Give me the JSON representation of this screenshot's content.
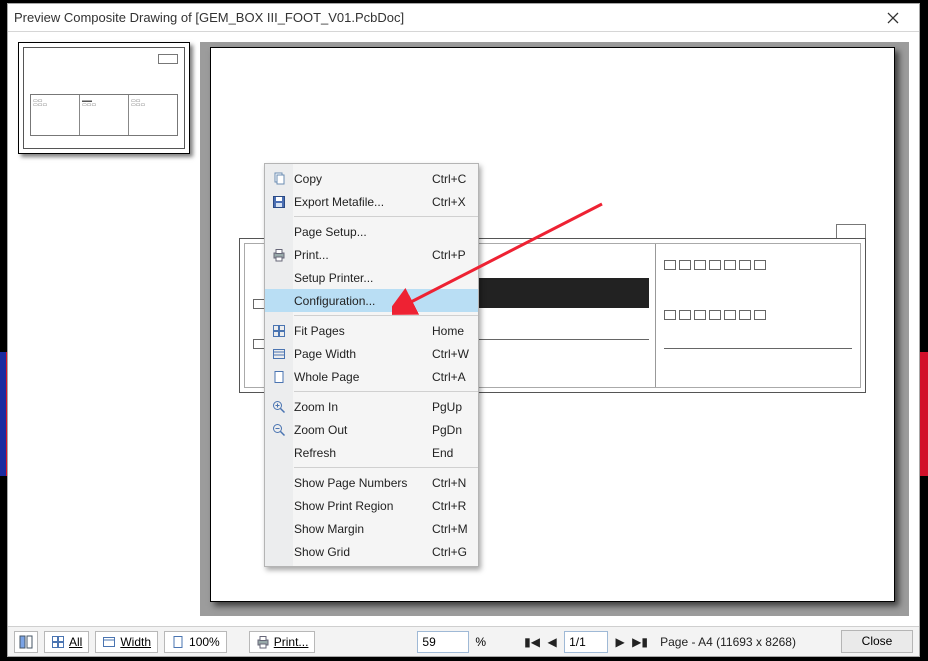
{
  "window": {
    "title": "Preview Composite Drawing of [GEM_BOX III_FOOT_V01.PcbDoc]"
  },
  "context_menu": {
    "groups": [
      [
        {
          "label": "Copy",
          "shortcut": "Ctrl+C",
          "icon": "copy-icon"
        },
        {
          "label": "Export Metafile...",
          "shortcut": "Ctrl+X",
          "icon": "save-icon"
        }
      ],
      [
        {
          "label": "Page Setup...",
          "shortcut": "",
          "icon": ""
        },
        {
          "label": "Print...",
          "shortcut": "Ctrl+P",
          "icon": "print-icon"
        },
        {
          "label": "Setup Printer...",
          "shortcut": "",
          "icon": ""
        },
        {
          "label": "Configuration...",
          "shortcut": "",
          "icon": "",
          "highlight": true
        }
      ],
      [
        {
          "label": "Fit Pages",
          "shortcut": "Home",
          "icon": "fit-icon"
        },
        {
          "label": "Page Width",
          "shortcut": "Ctrl+W",
          "icon": "width-icon"
        },
        {
          "label": "Whole Page",
          "shortcut": "Ctrl+A",
          "icon": "page-icon"
        }
      ],
      [
        {
          "label": "Zoom In",
          "shortcut": "PgUp",
          "icon": "zoom-in-icon"
        },
        {
          "label": "Zoom Out",
          "shortcut": "PgDn",
          "icon": "zoom-out-icon"
        },
        {
          "label": "Refresh",
          "shortcut": "End",
          "icon": ""
        }
      ],
      [
        {
          "label": "Show Page Numbers",
          "shortcut": "Ctrl+N",
          "icon": ""
        },
        {
          "label": "Show Print Region",
          "shortcut": "Ctrl+R",
          "icon": ""
        },
        {
          "label": "Show Margin",
          "shortcut": "Ctrl+M",
          "icon": ""
        },
        {
          "label": "Show Grid",
          "shortcut": "Ctrl+G",
          "icon": ""
        }
      ]
    ]
  },
  "footer": {
    "buttons": {
      "tile_label": "",
      "all_label": "All",
      "width_label": "Width",
      "hundred_label": "100%",
      "print_label": "Print..."
    },
    "zoom_value": "59",
    "zoom_pct": "%",
    "page_value": "1/1",
    "page_info": "Page - A4 (11693 x 8268)",
    "close_label": "Close"
  }
}
